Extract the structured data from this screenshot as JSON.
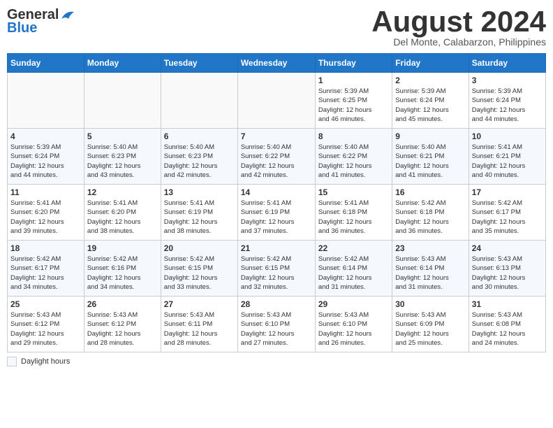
{
  "header": {
    "logo_line1": "General",
    "logo_line2": "Blue",
    "title": "August 2024",
    "subtitle": "Del Monte, Calabarzon, Philippines"
  },
  "days_of_week": [
    "Sunday",
    "Monday",
    "Tuesday",
    "Wednesday",
    "Thursday",
    "Friday",
    "Saturday"
  ],
  "footer": {
    "daylight_label": "Daylight hours"
  },
  "weeks": [
    {
      "days": [
        {
          "date": "",
          "info": ""
        },
        {
          "date": "",
          "info": ""
        },
        {
          "date": "",
          "info": ""
        },
        {
          "date": "",
          "info": ""
        },
        {
          "date": "1",
          "info": "Sunrise: 5:39 AM\nSunset: 6:25 PM\nDaylight: 12 hours\nand 46 minutes."
        },
        {
          "date": "2",
          "info": "Sunrise: 5:39 AM\nSunset: 6:24 PM\nDaylight: 12 hours\nand 45 minutes."
        },
        {
          "date": "3",
          "info": "Sunrise: 5:39 AM\nSunset: 6:24 PM\nDaylight: 12 hours\nand 44 minutes."
        }
      ]
    },
    {
      "days": [
        {
          "date": "4",
          "info": "Sunrise: 5:39 AM\nSunset: 6:24 PM\nDaylight: 12 hours\nand 44 minutes."
        },
        {
          "date": "5",
          "info": "Sunrise: 5:40 AM\nSunset: 6:23 PM\nDaylight: 12 hours\nand 43 minutes."
        },
        {
          "date": "6",
          "info": "Sunrise: 5:40 AM\nSunset: 6:23 PM\nDaylight: 12 hours\nand 42 minutes."
        },
        {
          "date": "7",
          "info": "Sunrise: 5:40 AM\nSunset: 6:22 PM\nDaylight: 12 hours\nand 42 minutes."
        },
        {
          "date": "8",
          "info": "Sunrise: 5:40 AM\nSunset: 6:22 PM\nDaylight: 12 hours\nand 41 minutes."
        },
        {
          "date": "9",
          "info": "Sunrise: 5:40 AM\nSunset: 6:21 PM\nDaylight: 12 hours\nand 41 minutes."
        },
        {
          "date": "10",
          "info": "Sunrise: 5:41 AM\nSunset: 6:21 PM\nDaylight: 12 hours\nand 40 minutes."
        }
      ]
    },
    {
      "days": [
        {
          "date": "11",
          "info": "Sunrise: 5:41 AM\nSunset: 6:20 PM\nDaylight: 12 hours\nand 39 minutes."
        },
        {
          "date": "12",
          "info": "Sunrise: 5:41 AM\nSunset: 6:20 PM\nDaylight: 12 hours\nand 38 minutes."
        },
        {
          "date": "13",
          "info": "Sunrise: 5:41 AM\nSunset: 6:19 PM\nDaylight: 12 hours\nand 38 minutes."
        },
        {
          "date": "14",
          "info": "Sunrise: 5:41 AM\nSunset: 6:19 PM\nDaylight: 12 hours\nand 37 minutes."
        },
        {
          "date": "15",
          "info": "Sunrise: 5:41 AM\nSunset: 6:18 PM\nDaylight: 12 hours\nand 36 minutes."
        },
        {
          "date": "16",
          "info": "Sunrise: 5:42 AM\nSunset: 6:18 PM\nDaylight: 12 hours\nand 36 minutes."
        },
        {
          "date": "17",
          "info": "Sunrise: 5:42 AM\nSunset: 6:17 PM\nDaylight: 12 hours\nand 35 minutes."
        }
      ]
    },
    {
      "days": [
        {
          "date": "18",
          "info": "Sunrise: 5:42 AM\nSunset: 6:17 PM\nDaylight: 12 hours\nand 34 minutes."
        },
        {
          "date": "19",
          "info": "Sunrise: 5:42 AM\nSunset: 6:16 PM\nDaylight: 12 hours\nand 34 minutes."
        },
        {
          "date": "20",
          "info": "Sunrise: 5:42 AM\nSunset: 6:15 PM\nDaylight: 12 hours\nand 33 minutes."
        },
        {
          "date": "21",
          "info": "Sunrise: 5:42 AM\nSunset: 6:15 PM\nDaylight: 12 hours\nand 32 minutes."
        },
        {
          "date": "22",
          "info": "Sunrise: 5:42 AM\nSunset: 6:14 PM\nDaylight: 12 hours\nand 31 minutes."
        },
        {
          "date": "23",
          "info": "Sunrise: 5:43 AM\nSunset: 6:14 PM\nDaylight: 12 hours\nand 31 minutes."
        },
        {
          "date": "24",
          "info": "Sunrise: 5:43 AM\nSunset: 6:13 PM\nDaylight: 12 hours\nand 30 minutes."
        }
      ]
    },
    {
      "days": [
        {
          "date": "25",
          "info": "Sunrise: 5:43 AM\nSunset: 6:12 PM\nDaylight: 12 hours\nand 29 minutes."
        },
        {
          "date": "26",
          "info": "Sunrise: 5:43 AM\nSunset: 6:12 PM\nDaylight: 12 hours\nand 28 minutes."
        },
        {
          "date": "27",
          "info": "Sunrise: 5:43 AM\nSunset: 6:11 PM\nDaylight: 12 hours\nand 28 minutes."
        },
        {
          "date": "28",
          "info": "Sunrise: 5:43 AM\nSunset: 6:10 PM\nDaylight: 12 hours\nand 27 minutes."
        },
        {
          "date": "29",
          "info": "Sunrise: 5:43 AM\nSunset: 6:10 PM\nDaylight: 12 hours\nand 26 minutes."
        },
        {
          "date": "30",
          "info": "Sunrise: 5:43 AM\nSunset: 6:09 PM\nDaylight: 12 hours\nand 25 minutes."
        },
        {
          "date": "31",
          "info": "Sunrise: 5:43 AM\nSunset: 6:08 PM\nDaylight: 12 hours\nand 24 minutes."
        }
      ]
    }
  ]
}
